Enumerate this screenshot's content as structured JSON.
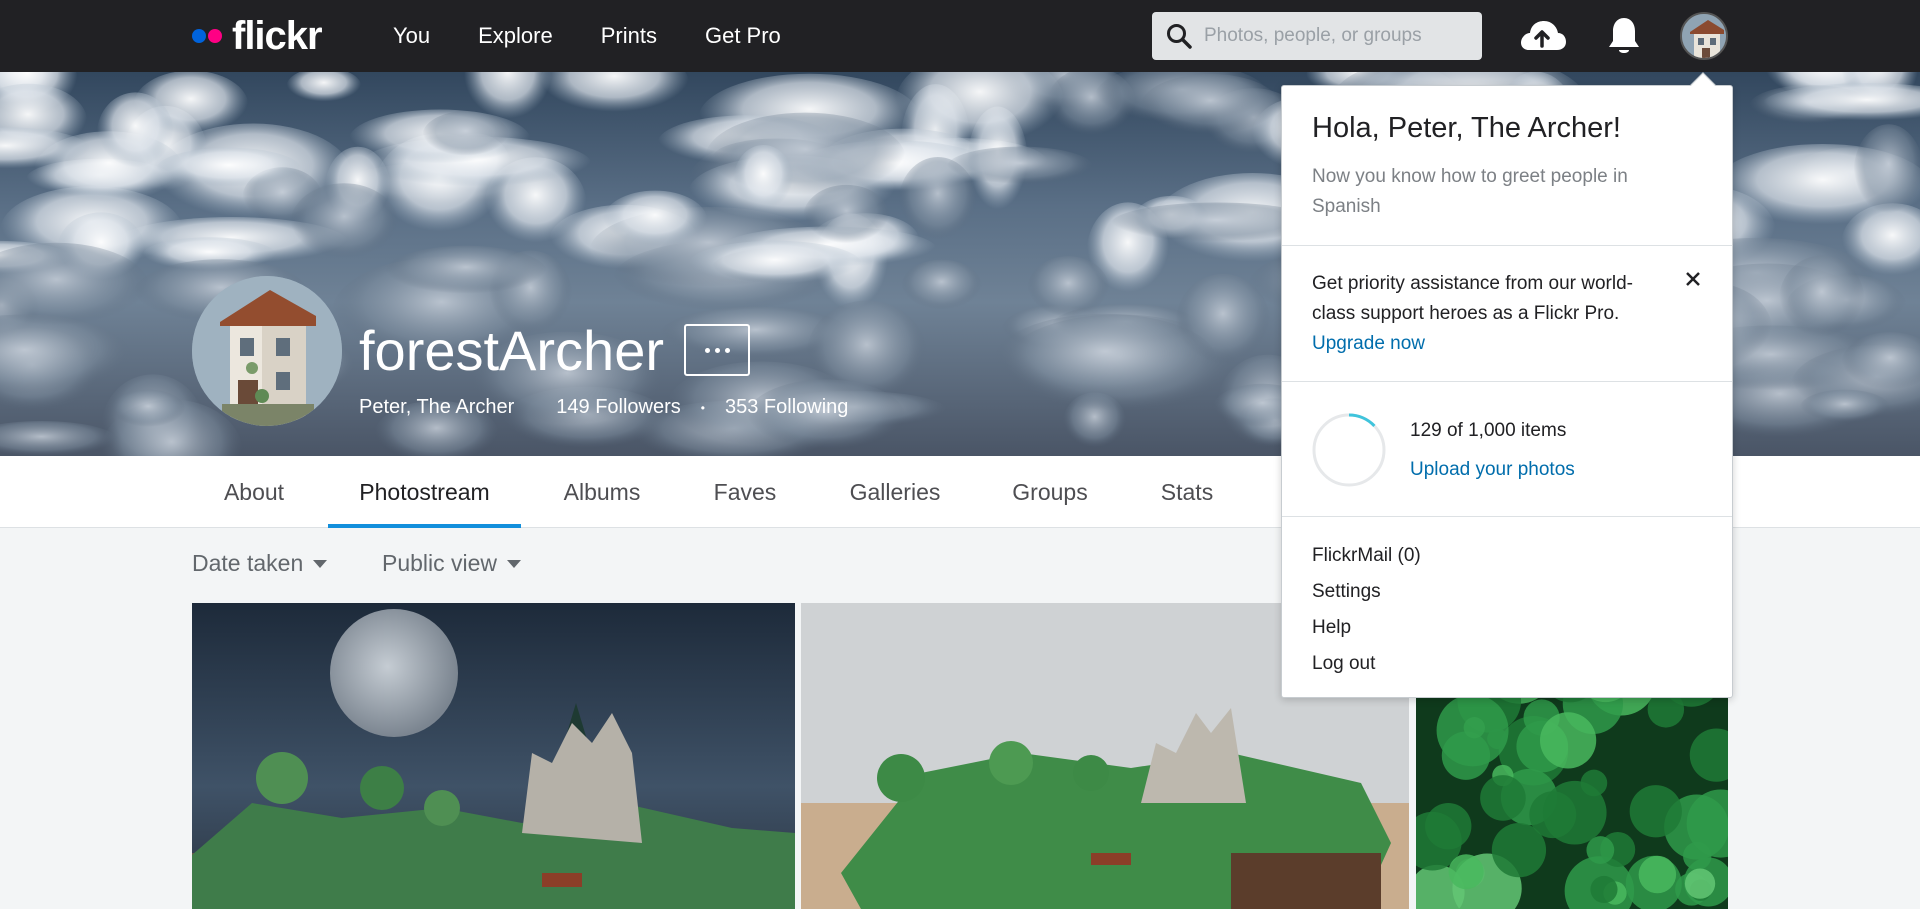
{
  "brand": {
    "name": "flickr",
    "blue": "#0063dc",
    "pink": "#ff0084",
    "nav_bg": "#212124",
    "link": "#006dac",
    "tab_accent": "#128fdc"
  },
  "nav": {
    "links": [
      "You",
      "Explore",
      "Prints",
      "Get Pro"
    ]
  },
  "search": {
    "placeholder": "Photos, people, or groups",
    "icon": "search-icon"
  },
  "header_icons": [
    "upload-cloud-icon",
    "bell-icon",
    "avatar"
  ],
  "profile": {
    "username": "forestArcher",
    "real_name": "Peter, The Archer",
    "followers": "149 Followers",
    "separator": "•",
    "following": "353 Following"
  },
  "tabs": [
    "About",
    "Photostream",
    "Albums",
    "Faves",
    "Galleries",
    "Groups",
    "Stats"
  ],
  "active_tab": "Photostream",
  "filters": {
    "sort": "Date taken",
    "view": "Public view"
  },
  "dropdown": {
    "greeting": "Hola, Peter, The Archer!",
    "greeting_sub": "Now you know how to greet people in Spanish",
    "promo_text": "Get priority assistance from our world-class support heroes as a Flickr Pro.",
    "promo_link": "Upgrade now",
    "usage_text": "129 of 1,000 items",
    "usage_fraction": 0.129,
    "upload_link": "Upload your photos",
    "menu": [
      "FlickrMail (0)",
      "Settings",
      "Help",
      "Log out"
    ]
  }
}
